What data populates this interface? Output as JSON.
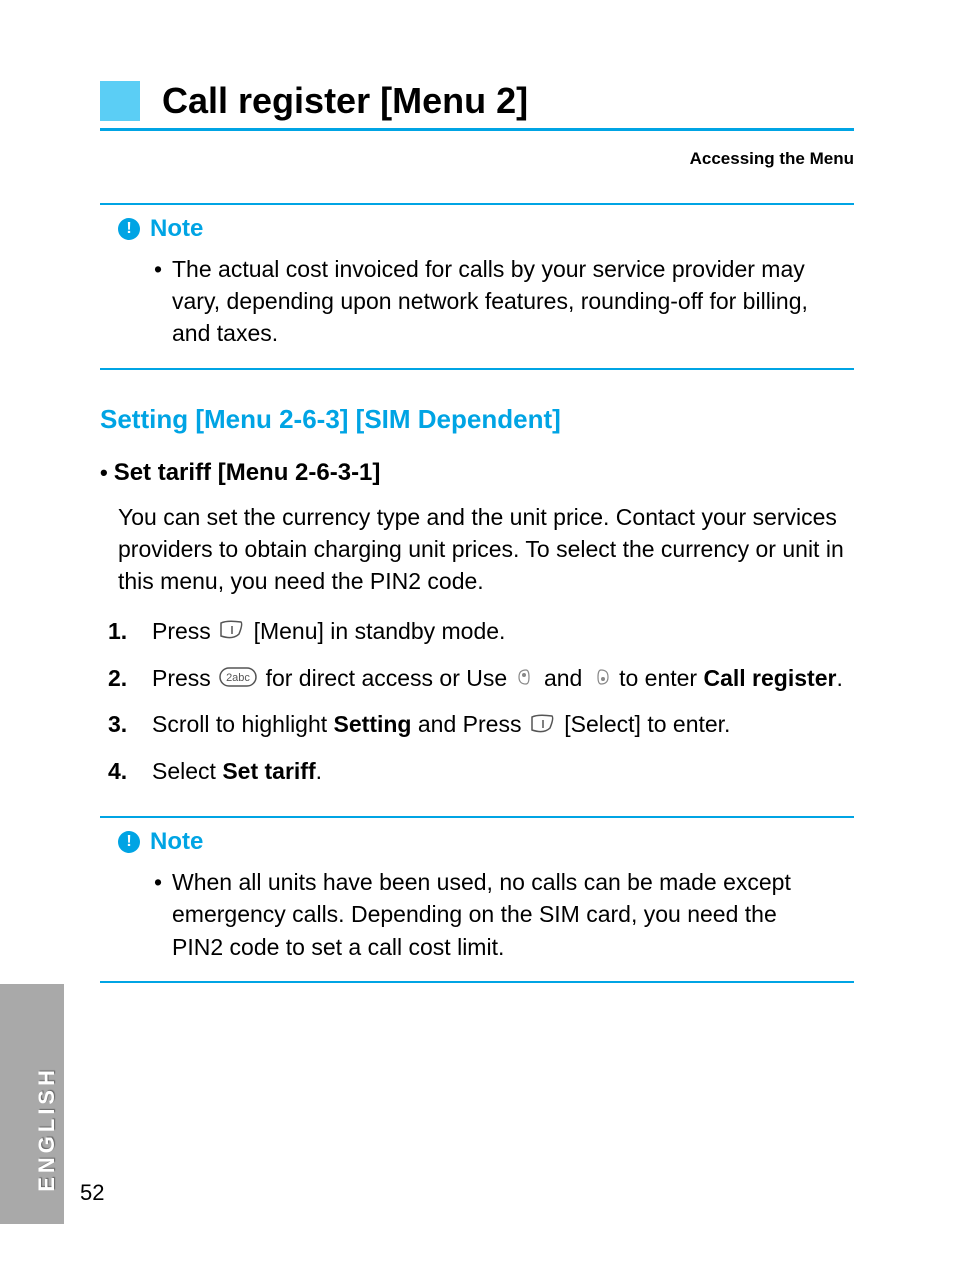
{
  "header": {
    "title": "Call register [Menu 2]",
    "breadcrumb": "Accessing the Menu"
  },
  "note1": {
    "label": "Note",
    "text": "The actual cost invoiced for calls by your service provider may vary, depending upon network features, rounding-off for billing, and taxes."
  },
  "section": {
    "heading": "Setting [Menu 2-6-3] [SIM Dependent]",
    "sub_heading": "Set tariff [Menu 2-6-3-1]",
    "intro": "You can set the currency type and the unit price. Contact your services providers to obtain charging unit prices. To select the currency or unit in this menu, you need the PIN2 code."
  },
  "steps": {
    "s1": {
      "num": "1.",
      "a": "Press ",
      "b": " [Menu] in standby mode."
    },
    "s2": {
      "num": "2.",
      "a": "Press ",
      "b": " for direct access or Use ",
      "c": " and ",
      "d": " to enter ",
      "bold": "Call register",
      "e": "."
    },
    "s3": {
      "num": "3.",
      "a": "Scroll to highlight ",
      "bold1": "Setting",
      "b": " and Press ",
      "c": " [Select] to enter."
    },
    "s4": {
      "num": "4.",
      "a": "Select ",
      "bold": "Set tariff",
      "b": "."
    }
  },
  "note2": {
    "label": "Note",
    "text": "When all units have been used, no calls can be made except emergency calls. Depending on the SIM card, you need the PIN2 code to set a call cost limit."
  },
  "footer": {
    "language": "ENGLISH",
    "page_number": "52"
  },
  "icons": {
    "bullet": "•",
    "dot": "•",
    "exclaim": "!"
  }
}
